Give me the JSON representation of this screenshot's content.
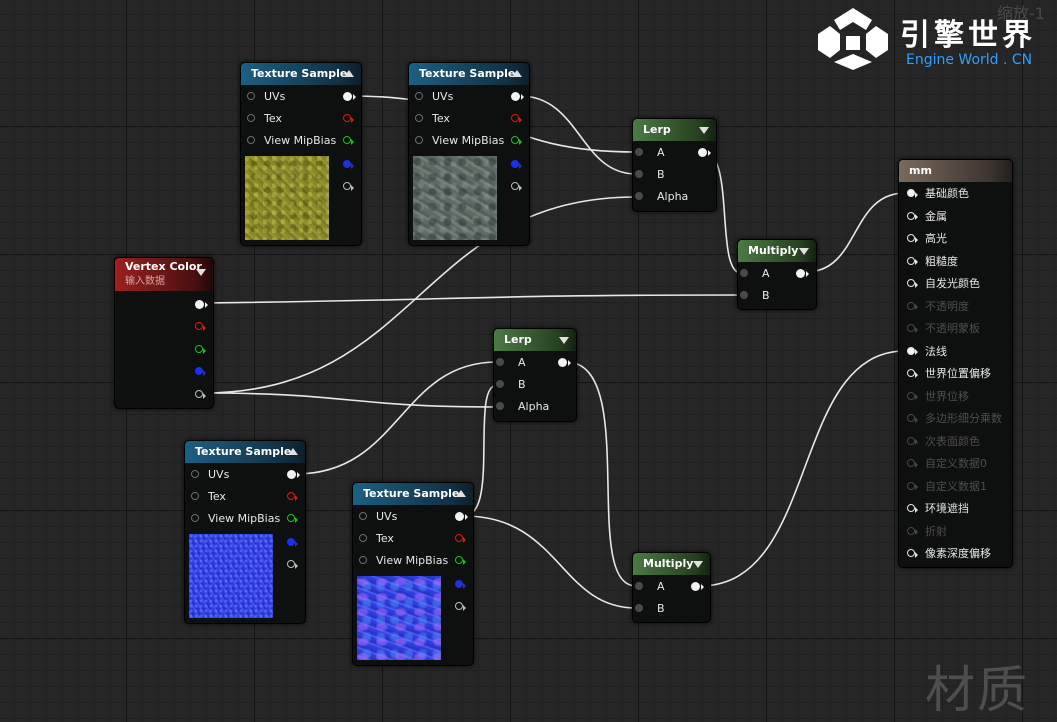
{
  "overlay": {
    "corner_text": "缩放-1",
    "logo_title": "引擎世界",
    "logo_subtitle": "Engine World . CN",
    "watermark": "材质"
  },
  "nodes": {
    "tex1": {
      "title": "Texture Sample",
      "pins": [
        "UVs",
        "Tex",
        "View MipBias"
      ],
      "preview": "yellow moss texture"
    },
    "tex2": {
      "title": "Texture Sample",
      "pins": [
        "UVs",
        "Tex",
        "View MipBias"
      ],
      "preview": "grey rock texture"
    },
    "tex3": {
      "title": "Texture Sample",
      "pins": [
        "UVs",
        "Tex",
        "View MipBias"
      ],
      "preview": "blue normal map"
    },
    "tex4": {
      "title": "Texture Sample",
      "pins": [
        "UVs",
        "Tex",
        "View MipBias"
      ],
      "preview": "blue normal map"
    },
    "lerp1": {
      "title": "Lerp",
      "pins": [
        "A",
        "B",
        "Alpha"
      ]
    },
    "lerp2": {
      "title": "Lerp",
      "pins": [
        "A",
        "B",
        "Alpha"
      ]
    },
    "mult1": {
      "title": "Multiply",
      "pins": [
        "A",
        "B"
      ]
    },
    "mult2": {
      "title": "Multiply",
      "pins": [
        "A",
        "B"
      ]
    },
    "vertex": {
      "title": "Vertex Color",
      "subtitle": "输入数据"
    },
    "material": {
      "title": "mm",
      "pins": [
        {
          "label": "基础颜色",
          "enabled": true,
          "connected": true
        },
        {
          "label": "金属",
          "enabled": true,
          "connected": false
        },
        {
          "label": "高光",
          "enabled": true,
          "connected": false
        },
        {
          "label": "粗糙度",
          "enabled": true,
          "connected": false
        },
        {
          "label": "自发光颜色",
          "enabled": true,
          "connected": false
        },
        {
          "label": "不透明度",
          "enabled": false,
          "connected": false
        },
        {
          "label": "不透明蒙板",
          "enabled": false,
          "connected": false
        },
        {
          "label": "法线",
          "enabled": true,
          "connected": true
        },
        {
          "label": "世界位置偏移",
          "enabled": true,
          "connected": false
        },
        {
          "label": "世界位移",
          "enabled": false,
          "connected": false
        },
        {
          "label": "多边形细分乘数",
          "enabled": false,
          "connected": false
        },
        {
          "label": "次表面颜色",
          "enabled": false,
          "connected": false
        },
        {
          "label": "自定义数据0",
          "enabled": false,
          "connected": false
        },
        {
          "label": "自定义数据1",
          "enabled": false,
          "connected": false
        },
        {
          "label": "环境遮挡",
          "enabled": true,
          "connected": false
        },
        {
          "label": "折射",
          "enabled": false,
          "connected": false
        },
        {
          "label": "像素深度偏移",
          "enabled": true,
          "connected": false
        }
      ]
    }
  },
  "colors": {
    "texture_header": "#1d5f82",
    "math_header": "#4b7a45",
    "vertex_header": "#9c2020",
    "material_header": "#7a6a5c",
    "pin_red": "#e21717",
    "pin_green": "#17c817",
    "pin_blue": "#1f2fe6",
    "wire": "#e8e8e8",
    "logo_accent": "#2fa0ff"
  }
}
